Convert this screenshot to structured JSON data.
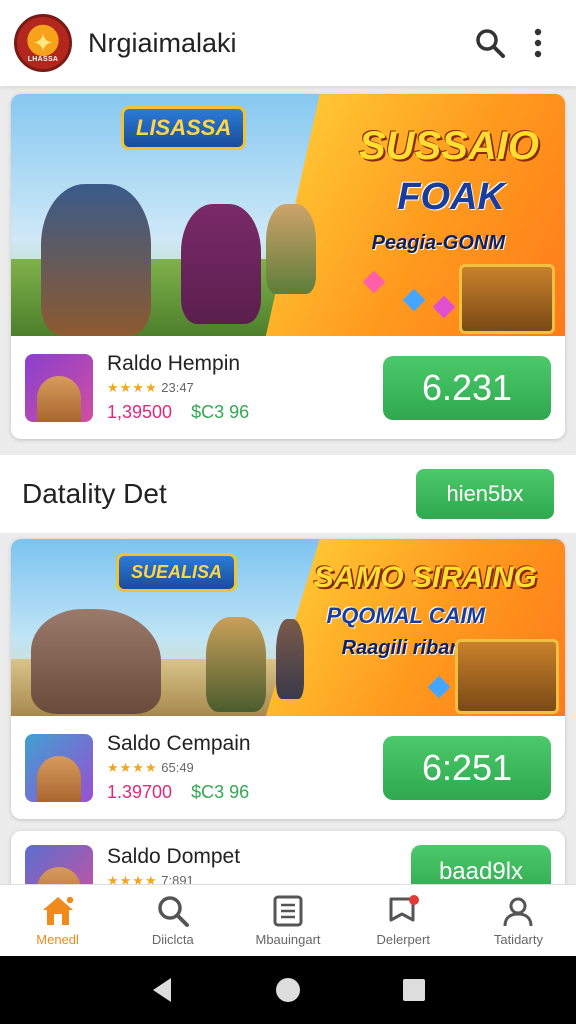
{
  "app": {
    "title": "Nrgiaimalaki",
    "logo_text": "LHASSA"
  },
  "cards": [
    {
      "game_logo": "LISASSA",
      "headline1": "SUSSAIO",
      "headline2": "FOAK",
      "headline3": "Peagia-GONM",
      "name": "Raldo Hempin",
      "rating": "23:47",
      "price_old": "1,39500",
      "price_new": "$C3 96",
      "cta": "6.231"
    },
    {
      "game_logo": "SUEALISA",
      "headline1": "SAMO SIRAING",
      "headline2": "PQOMAL CAIM",
      "headline3": "Raagili riban!!",
      "name": "Saldo Cempain",
      "rating": "65:49",
      "price_old": "1.39700",
      "price_new": "$C3 96",
      "cta": "6:251"
    },
    {
      "name": "Saldo Dompet",
      "rating": "7:891",
      "cta": "baad9lx"
    }
  ],
  "section": {
    "title": "Datality Det",
    "button": "hien5bx"
  },
  "nav": [
    {
      "label": "Menedl",
      "icon": "home-icon",
      "active": true
    },
    {
      "label": "Diiclcta",
      "icon": "search-icon"
    },
    {
      "label": "Mbauingart",
      "icon": "list-icon"
    },
    {
      "label": "Delerpert",
      "icon": "bookmark-icon"
    },
    {
      "label": "Tatidarty",
      "icon": "profile-icon"
    }
  ],
  "colors": {
    "accent": "#f08a1c",
    "cta_green": "#34a853",
    "price_pink": "#e0297a"
  }
}
